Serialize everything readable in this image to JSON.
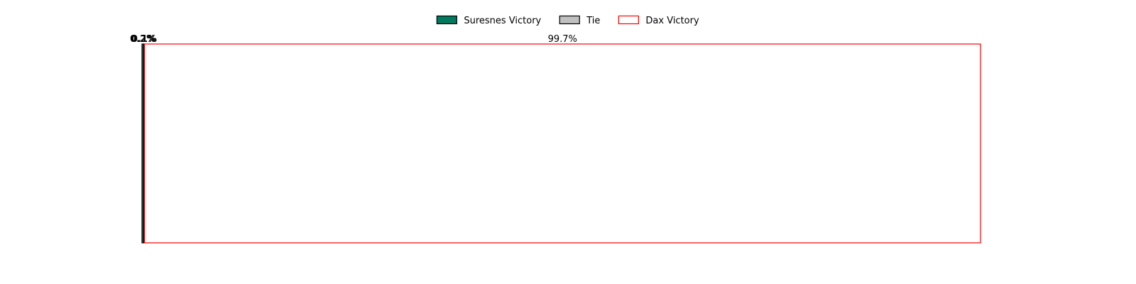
{
  "chart_data": {
    "type": "bar",
    "orientation": "horizontal-stacked",
    "title": "",
    "xlabel": "",
    "ylabel": "",
    "xlim": [
      0,
      100
    ],
    "grid": false,
    "legend_placement": "top-center",
    "series": [
      {
        "name": "Suresnes Victory",
        "value": 0.2,
        "label": "0.2%",
        "fill": "#007a5e",
        "stroke": "#000000"
      },
      {
        "name": "Tie",
        "value": 0.1,
        "label": "0.1%",
        "fill": "#c0c0c0",
        "stroke": "#000000"
      },
      {
        "name": "Dax Victory",
        "value": 99.7,
        "label": "99.7%",
        "fill": "#ffffff",
        "stroke": "#ff0000"
      }
    ]
  }
}
